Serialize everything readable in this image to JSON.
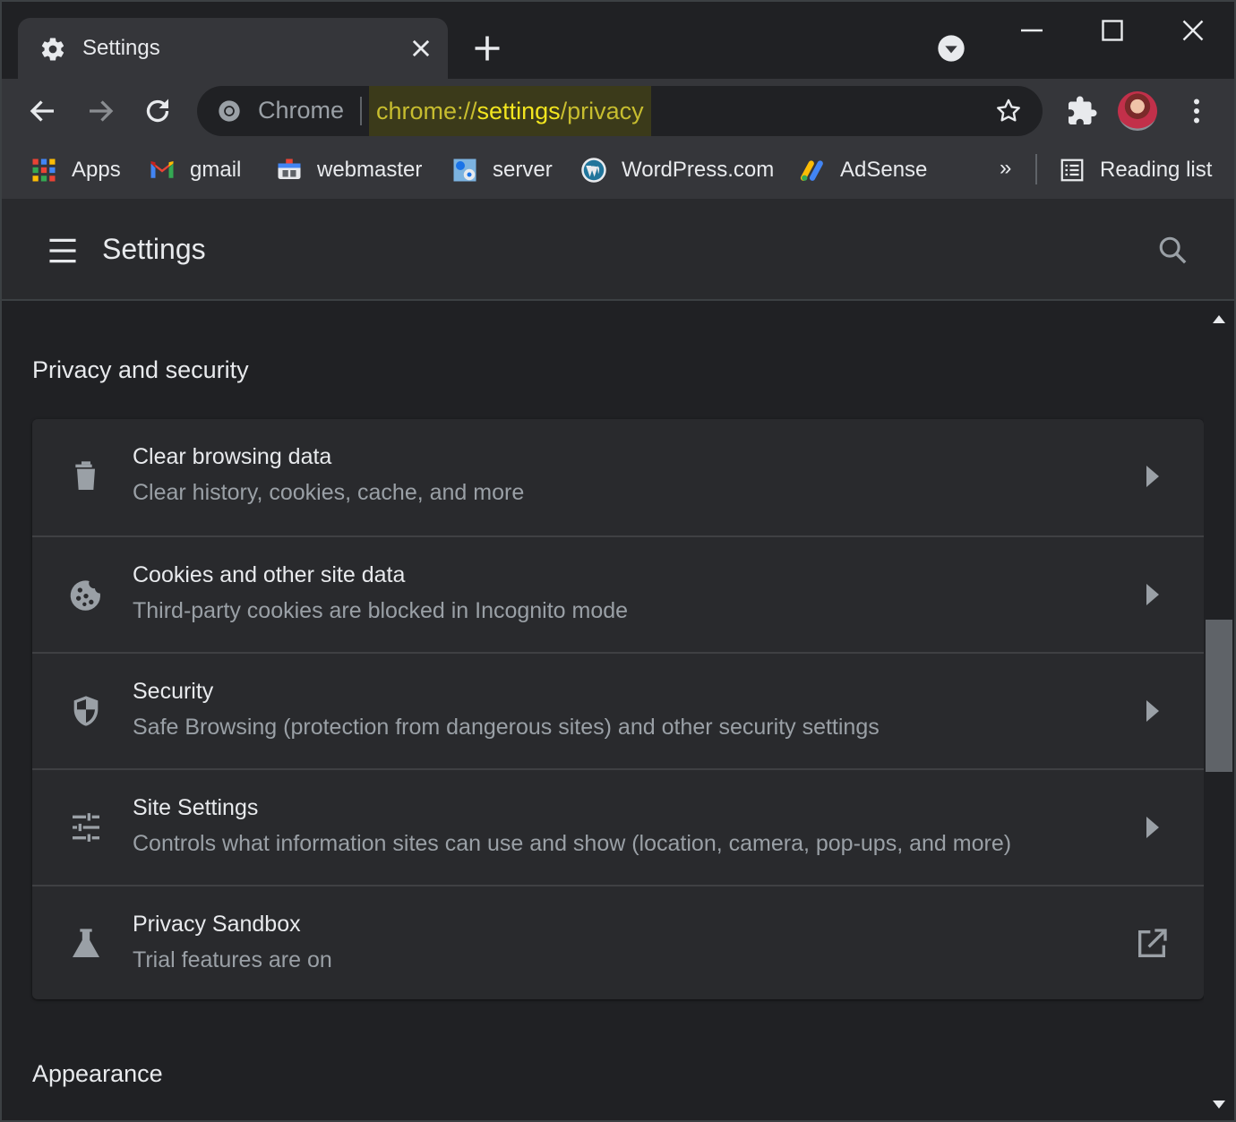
{
  "tab": {
    "title": "Settings"
  },
  "omnibox": {
    "chip": "Chrome",
    "url_scheme": "chrome://",
    "url_host": "settings",
    "url_path": "/privacy"
  },
  "bookmarks": [
    {
      "label": "Apps",
      "icon": "apps-grid-icon"
    },
    {
      "label": "gmail",
      "icon": "gmail-icon"
    },
    {
      "label": "webmaster",
      "icon": "webmaster-icon"
    },
    {
      "label": "server",
      "icon": "server-icon"
    },
    {
      "label": "WordPress.com",
      "icon": "wordpress-icon"
    },
    {
      "label": "AdSense",
      "icon": "adsense-icon"
    }
  ],
  "bookmarks_more": "»",
  "reading_list": "Reading list",
  "settings_header": {
    "title": "Settings"
  },
  "sections": {
    "privacy": {
      "title": "Privacy and security",
      "rows": [
        {
          "title": "Clear browsing data",
          "subtitle": "Clear history, cookies, cache, and more",
          "icon": "trash-icon"
        },
        {
          "title": "Cookies and other site data",
          "subtitle": "Third-party cookies are blocked in Incognito mode",
          "icon": "cookie-icon"
        },
        {
          "title": "Security",
          "subtitle": "Safe Browsing (protection from dangerous sites) and other security settings",
          "icon": "shield-icon"
        },
        {
          "title": "Site Settings",
          "subtitle": "Controls what information sites can use and show (location, camera, pop-ups, and more)",
          "icon": "tune-icon"
        },
        {
          "title": "Privacy Sandbox",
          "subtitle": "Trial features are on",
          "icon": "flask-icon"
        }
      ]
    },
    "appearance": {
      "title": "Appearance"
    }
  },
  "colors": {
    "frame": "#202124",
    "toolbar": "#35363a",
    "card": "#292a2d",
    "text_primary": "#e8eaed",
    "text_secondary": "#9aa0a6",
    "url_highlight": "#f2e51f"
  }
}
